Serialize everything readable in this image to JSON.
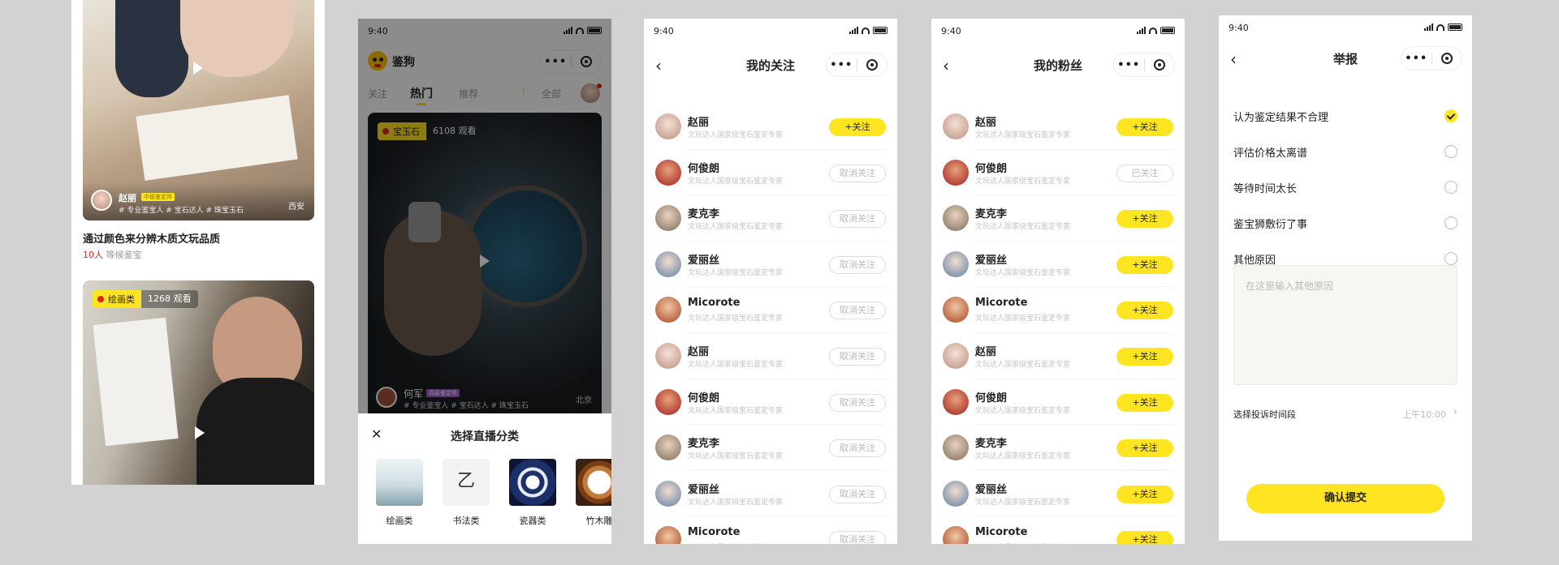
{
  "status_time": "9:40",
  "panel1": {
    "card1": {
      "name": "赵丽",
      "badge": "中级鉴定师",
      "tags": "# 专业鉴宝人 # 宝石达人 # 珠宝玉石",
      "city": "西安",
      "title": "通过颜色来分辨木质文玩品质",
      "wait_count": "10人",
      "wait_text": "等候鉴宝"
    },
    "card2": {
      "category": "绘画类",
      "views": "1268 观看"
    }
  },
  "panel2": {
    "app_name": "鉴狗",
    "tabs": [
      "关注",
      "热门",
      "推荐"
    ],
    "filter_label": "全部",
    "live": {
      "category": "宝玉石",
      "views": "6108 观看",
      "name": "何军",
      "badge": "高级鉴定师",
      "tags": "# 专业鉴宝人 # 宝石达人 # 珠宝玉石",
      "city": "北京"
    },
    "sheet": {
      "title": "选择直播分类",
      "categories": [
        "绘画类",
        "书法类",
        "瓷器类",
        "竹木雕"
      ]
    }
  },
  "desc": "文玩达人国家级宝石鉴定专家",
  "panel3": {
    "title": "我的关注",
    "rows": [
      {
        "name": "赵丽",
        "btn": "+关注",
        "style": "y"
      },
      {
        "name": "何俊朗",
        "btn": "取消关注",
        "style": "o"
      },
      {
        "name": "麦克李",
        "btn": "取消关注",
        "style": "o"
      },
      {
        "name": "爱丽丝",
        "btn": "取消关注",
        "style": "o"
      },
      {
        "name": "Micorote",
        "btn": "取消关注",
        "style": "o"
      },
      {
        "name": "赵丽",
        "btn": "取消关注",
        "style": "o"
      },
      {
        "name": "何俊朗",
        "btn": "取消关注",
        "style": "o"
      },
      {
        "name": "麦克李",
        "btn": "取消关注",
        "style": "o"
      },
      {
        "name": "爱丽丝",
        "btn": "取消关注",
        "style": "o"
      },
      {
        "name": "Micorote",
        "btn": "取消关注",
        "style": "o"
      }
    ]
  },
  "panel4": {
    "title": "我的粉丝",
    "rows": [
      {
        "name": "赵丽",
        "btn": "+关注",
        "style": "y"
      },
      {
        "name": "何俊朗",
        "btn": "已关注",
        "style": "o"
      },
      {
        "name": "麦克李",
        "btn": "+关注",
        "style": "y"
      },
      {
        "name": "爱丽丝",
        "btn": "+关注",
        "style": "y"
      },
      {
        "name": "Micorote",
        "btn": "+关注",
        "style": "y"
      },
      {
        "name": "赵丽",
        "btn": "+关注",
        "style": "y"
      },
      {
        "name": "何俊朗",
        "btn": "+关注",
        "style": "y"
      },
      {
        "name": "麦克李",
        "btn": "+关注",
        "style": "y"
      },
      {
        "name": "爱丽丝",
        "btn": "+关注",
        "style": "y"
      },
      {
        "name": "Micorote",
        "btn": "+关注",
        "style": "y"
      }
    ]
  },
  "panel5": {
    "title": "举报",
    "options": [
      {
        "label": "认为鉴定结果不合理",
        "checked": true
      },
      {
        "label": "评估价格太离谱",
        "checked": false
      },
      {
        "label": "等待时间太长",
        "checked": false
      },
      {
        "label": "鉴宝狮敷衍了事",
        "checked": false
      },
      {
        "label": "其他原因",
        "checked": false
      }
    ],
    "textarea_placeholder": "在这里输入其他原因",
    "time_label": "选择投诉时间段",
    "time_value": "上午10:00",
    "submit": "确认提交"
  },
  "colors": {
    "accent": "#ffe421",
    "background": "#d2d2d2"
  }
}
